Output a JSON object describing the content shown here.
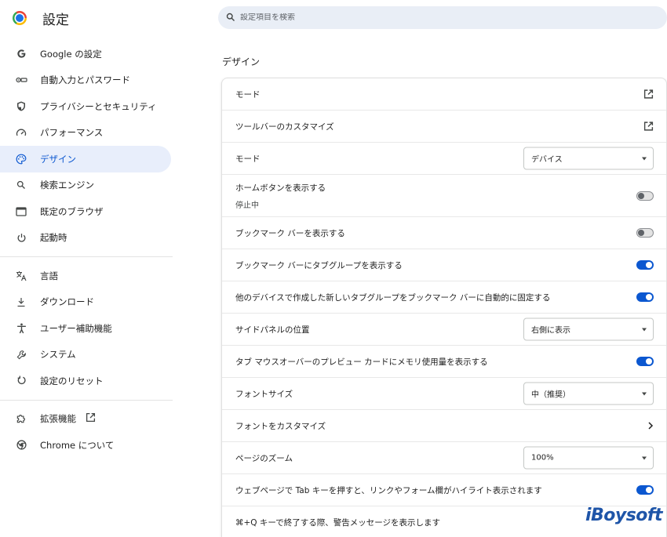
{
  "app": {
    "title": "設定"
  },
  "search": {
    "placeholder": "設定項目を検索"
  },
  "sidebar": {
    "items": [
      {
        "label": "Google の設定",
        "icon": "google-g-icon",
        "active": false
      },
      {
        "label": "自動入力とパスワード",
        "icon": "key-icon",
        "active": false
      },
      {
        "label": "プライバシーとセキュリティ",
        "icon": "shield-icon",
        "active": false
      },
      {
        "label": "パフォーマンス",
        "icon": "speedometer-icon",
        "active": false
      },
      {
        "label": "デザイン",
        "icon": "palette-icon",
        "active": true
      },
      {
        "label": "検索エンジン",
        "icon": "search-icon",
        "active": false
      },
      {
        "label": "既定のブラウザ",
        "icon": "browser-window-icon",
        "active": false
      },
      {
        "label": "起動時",
        "icon": "power-icon",
        "active": false
      }
    ],
    "items2": [
      {
        "label": "言語",
        "icon": "translate-icon"
      },
      {
        "label": "ダウンロード",
        "icon": "download-icon"
      },
      {
        "label": "ユーザー補助機能",
        "icon": "accessibility-icon"
      },
      {
        "label": "システム",
        "icon": "wrench-icon"
      },
      {
        "label": "設定のリセット",
        "icon": "reset-icon"
      }
    ],
    "items3": [
      {
        "label": "拡張機能",
        "icon": "puzzle-icon"
      },
      {
        "label": "Chrome について",
        "icon": "chrome-icon"
      }
    ]
  },
  "section": {
    "title": "デザイン"
  },
  "rows": [
    {
      "label": "モード",
      "control": "external-link",
      "icon": "external-link-icon"
    },
    {
      "label": "ツールバーのカスタマイズ",
      "control": "external-link",
      "icon": "external-link-icon"
    },
    {
      "label": "モード",
      "control": "select",
      "value": "デバイス"
    },
    {
      "label": "ホームボタンを表示する",
      "sub": "停止中",
      "control": "toggle",
      "on": false
    },
    {
      "label": "ブックマーク バーを表示する",
      "control": "toggle",
      "on": false
    },
    {
      "label": "ブックマーク バーにタブグループを表示する",
      "control": "toggle",
      "on": true
    },
    {
      "label": "他のデバイスで作成した新しいタブグループをブックマーク バーに自動的に固定する",
      "control": "toggle",
      "on": true
    },
    {
      "label": "サイドパネルの位置",
      "control": "select",
      "value": "右側に表示"
    },
    {
      "label": "タブ マウスオーバーのプレビュー カードにメモリ使用量を表示する",
      "control": "toggle",
      "on": true
    },
    {
      "label": "フォントサイズ",
      "control": "select",
      "value": "中（推奨）"
    },
    {
      "label": "フォントをカスタマイズ",
      "control": "chevron",
      "icon": "chevron-right-icon"
    },
    {
      "label": "ページのズーム",
      "control": "select",
      "value": "100%"
    },
    {
      "label": "ウェブページで Tab キーを押すと、リンクやフォーム欄がハイライト表示されます",
      "control": "toggle",
      "on": true
    },
    {
      "label": "⌘+Q キーで終了する際、警告メッセージを表示します",
      "control": "none"
    }
  ],
  "watermark": {
    "text": "iBoysoft"
  },
  "colors": {
    "accent": "#0b57d0",
    "active_bg": "#e8eefb",
    "search_bg": "#e9eef6"
  }
}
